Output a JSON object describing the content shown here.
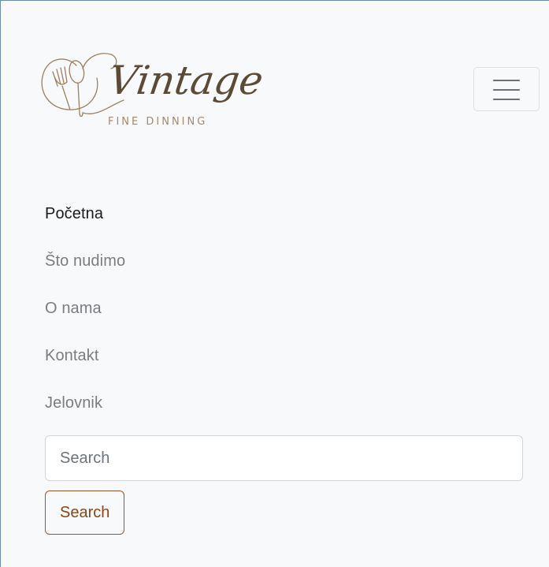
{
  "brand": {
    "name": "Vintage",
    "tagline": "FINE DINNING",
    "colors": {
      "logo_script": "#5a4a36",
      "logo_tagline": "#a38a6b",
      "logo_line": "#9a8162"
    }
  },
  "navbar": {
    "toggler_icon": "hamburger-menu-icon"
  },
  "nav": {
    "items": [
      {
        "label": "Početna",
        "active": true
      },
      {
        "label": "Što nudimo",
        "active": false
      },
      {
        "label": "O nama",
        "active": false
      },
      {
        "label": "Kontakt",
        "active": false
      },
      {
        "label": "Jelovnik",
        "active": false
      }
    ]
  },
  "search": {
    "placeholder": "Search",
    "value": "",
    "button_label": "Search",
    "button_color": "#a0522d"
  }
}
